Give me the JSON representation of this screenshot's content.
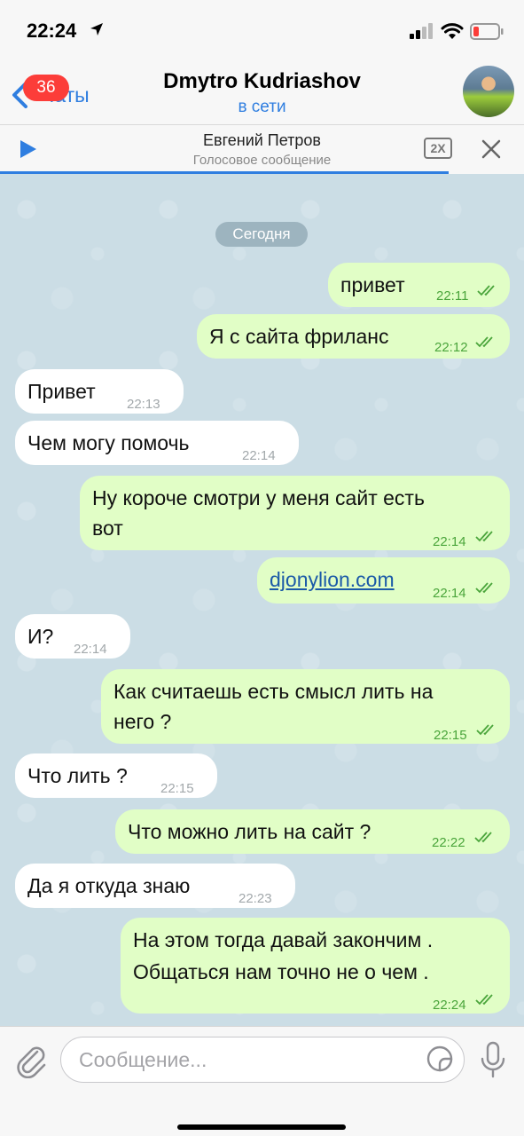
{
  "status_bar": {
    "time": "22:24"
  },
  "header": {
    "back_label": "Чаты",
    "unread_badge": "36",
    "title": "Dmytro Kudriashov",
    "status": "в сети"
  },
  "player": {
    "name": "Евгений Петров",
    "subtitle": "Голосовое сообщение",
    "speed": "2X"
  },
  "chat": {
    "date_label": "Сегодня",
    "messages": [
      {
        "dir": "out",
        "text": "привет",
        "time": "22:11"
      },
      {
        "dir": "out",
        "text": "Я с сайта фриланс",
        "time": "22:12"
      },
      {
        "dir": "in",
        "text": "Привет",
        "time": "22:13"
      },
      {
        "dir": "in",
        "text": "Чем могу помочь",
        "time": "22:14"
      },
      {
        "dir": "out",
        "text_line1": "Ну короче смотри у меня сайт есть",
        "text_line2": "вот",
        "time": "22:14"
      },
      {
        "dir": "out",
        "link": "djonylion.com",
        "time": "22:14"
      },
      {
        "dir": "in",
        "text": "И?",
        "time": "22:14"
      },
      {
        "dir": "out",
        "text_line1": "Как считаешь есть смысл лить на",
        "text_line2": "него ?",
        "time": "22:15"
      },
      {
        "dir": "in",
        "text": "Что лить ?",
        "time": "22:15"
      },
      {
        "dir": "out",
        "text": "Что можно лить на сайт ?",
        "time": "22:22"
      },
      {
        "dir": "in",
        "text": "Да я откуда знаю",
        "time": "22:23"
      },
      {
        "dir": "out",
        "text_line1": "На этом тогда давай закончим .",
        "text_line2": "Общаться нам точно не о чем .",
        "time": "22:24"
      }
    ]
  },
  "input": {
    "placeholder": "Сообщение..."
  },
  "colors": {
    "accent": "#2f7ee0",
    "outgoing_bubble": "#e1fec6",
    "incoming_bubble": "#ffffff",
    "badge": "#fc3d39",
    "chat_bg": "#cbdde5"
  },
  "icons": [
    "location-arrow-icon",
    "signal-icon",
    "wifi-icon",
    "battery-icon",
    "chevron-left-icon",
    "play-icon",
    "close-icon",
    "double-check-icon",
    "paperclip-icon",
    "sticker-icon",
    "microphone-icon"
  ]
}
